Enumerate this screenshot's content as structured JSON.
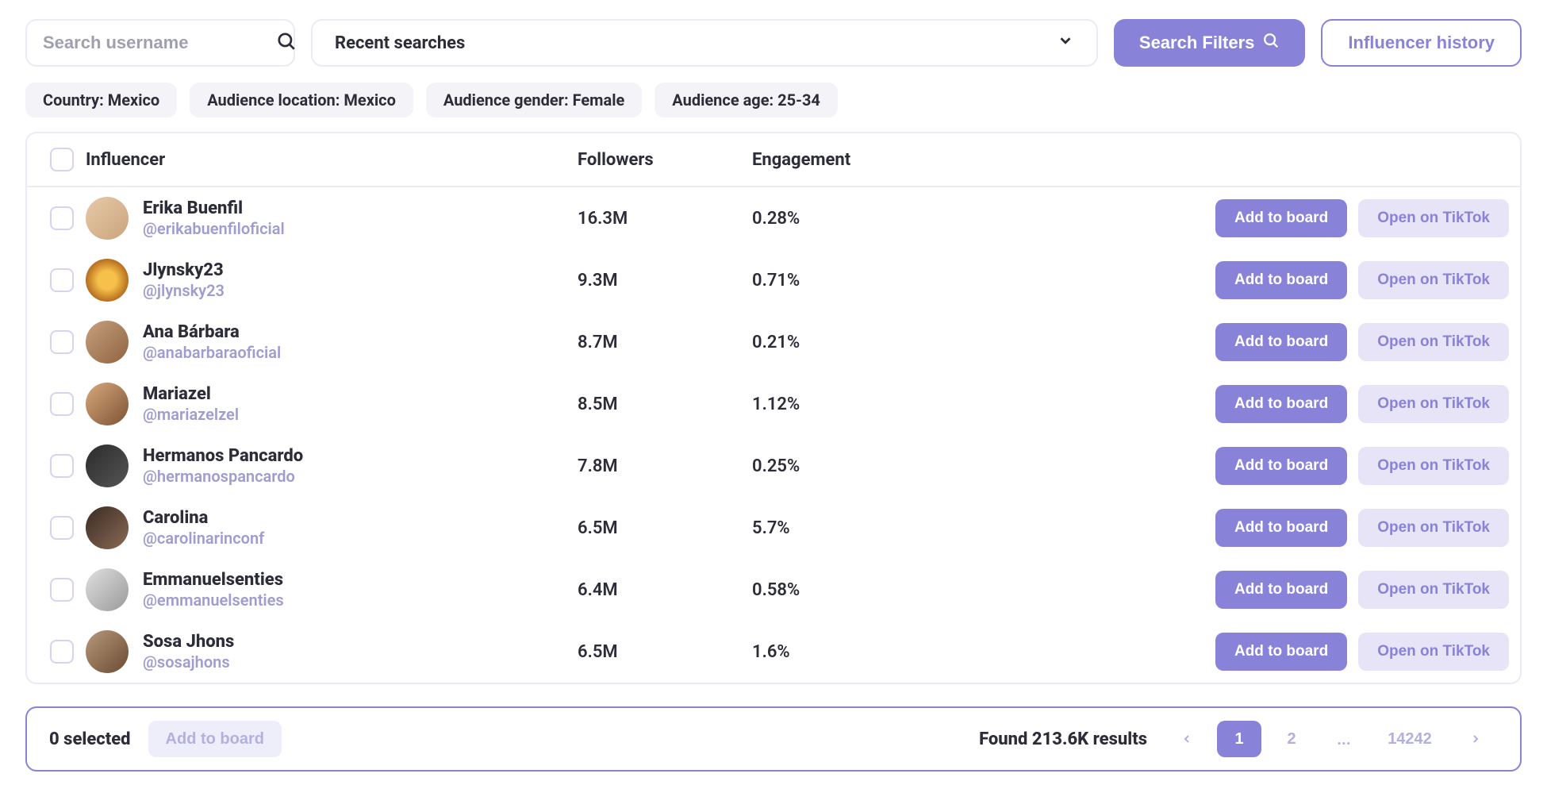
{
  "search": {
    "placeholder": "Search username"
  },
  "recent_searches_label": "Recent searches",
  "buttons": {
    "search_filters": "Search Filters",
    "influencer_history": "Influencer history",
    "add_to_board": "Add to board",
    "open_on_tiktok": "Open on TikTok"
  },
  "filters": [
    "Country: Mexico",
    "Audience location: Mexico",
    "Audience gender: Female",
    "Audience age: 25-34"
  ],
  "columns": {
    "influencer": "Influencer",
    "followers": "Followers",
    "engagement": "Engagement"
  },
  "rows": [
    {
      "name": "Erika Buenfil",
      "handle": "@erikabuenfiloficial",
      "followers": "16.3M",
      "engagement": "0.28%"
    },
    {
      "name": "Jlynsky23",
      "handle": "@jlynsky23",
      "followers": "9.3M",
      "engagement": "0.71%"
    },
    {
      "name": "Ana Bárbara",
      "handle": "@anabarbaraoficial",
      "followers": "8.7M",
      "engagement": "0.21%"
    },
    {
      "name": "Mariazel",
      "handle": "@mariazelzel",
      "followers": "8.5M",
      "engagement": "1.12%"
    },
    {
      "name": "Hermanos Pancardo",
      "handle": "@hermanospancardo",
      "followers": "7.8M",
      "engagement": "0.25%"
    },
    {
      "name": "Carolina",
      "handle": "@carolinarinconf",
      "followers": "6.5M",
      "engagement": "5.7%"
    },
    {
      "name": "Emmanuelsenties",
      "handle": "@emmanuelsenties",
      "followers": "6.4M",
      "engagement": "0.58%"
    },
    {
      "name": "Sosa Jhons",
      "handle": "@sosajhons",
      "followers": "6.5M",
      "engagement": "1.6%"
    }
  ],
  "footer": {
    "selected": "0 selected",
    "add_to_board": "Add to board",
    "results": "Found 213.6K results",
    "pages": {
      "current": "1",
      "next": "2",
      "ellipsis": "...",
      "last": "14242"
    }
  }
}
